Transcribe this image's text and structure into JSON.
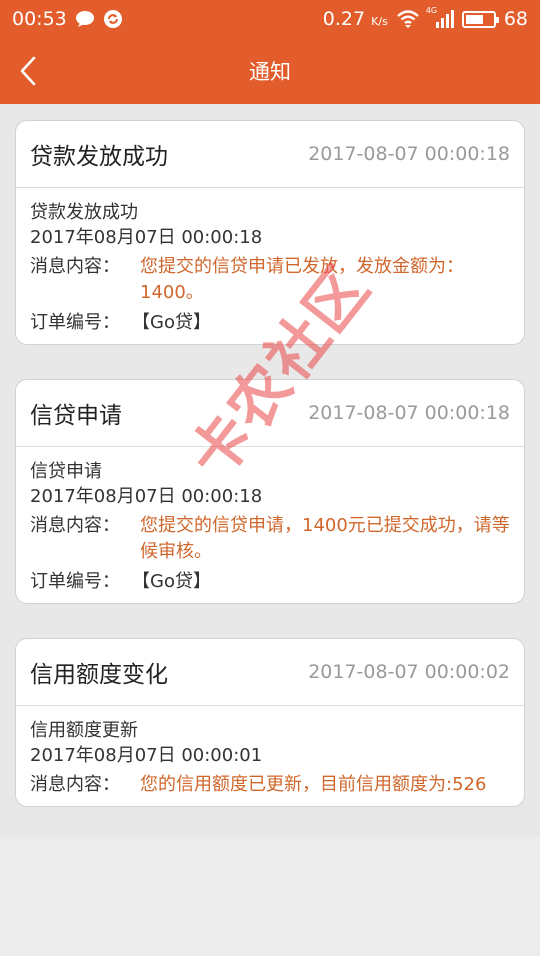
{
  "status_bar": {
    "time": "00:53",
    "speed": "0.27",
    "speed_unit": "K/s",
    "network": "4G",
    "battery": "68",
    "battery_level": 0.68
  },
  "nav": {
    "title": "通知"
  },
  "watermark": "卡农社区",
  "notifications": [
    {
      "title": "贷款发放成功",
      "time": "2017-08-07 00:00:18",
      "subject": "贷款发放成功",
      "datetime": "2017年08月07日 00:00:18",
      "content_label": "消息内容：",
      "content": "您提交的信贷申请已发放，发放金额为：1400。",
      "order_label": "订单编号：",
      "order": "【Go贷】"
    },
    {
      "title": "信贷申请",
      "time": "2017-08-07 00:00:18",
      "subject": "信贷申请",
      "datetime": "2017年08月07日 00:00:18",
      "content_label": "消息内容：",
      "content": "您提交的信贷申请，1400元已提交成功，请等候审核。",
      "order_label": "订单编号：",
      "order": "【Go贷】"
    },
    {
      "title": "信用额度变化",
      "time": "2017-08-07 00:00:02",
      "subject": "信用额度更新",
      "datetime": "2017年08月07日 00:00:01",
      "content_label": "消息内容：",
      "content": "您的信用额度已更新，目前信用额度为:526"
    }
  ]
}
